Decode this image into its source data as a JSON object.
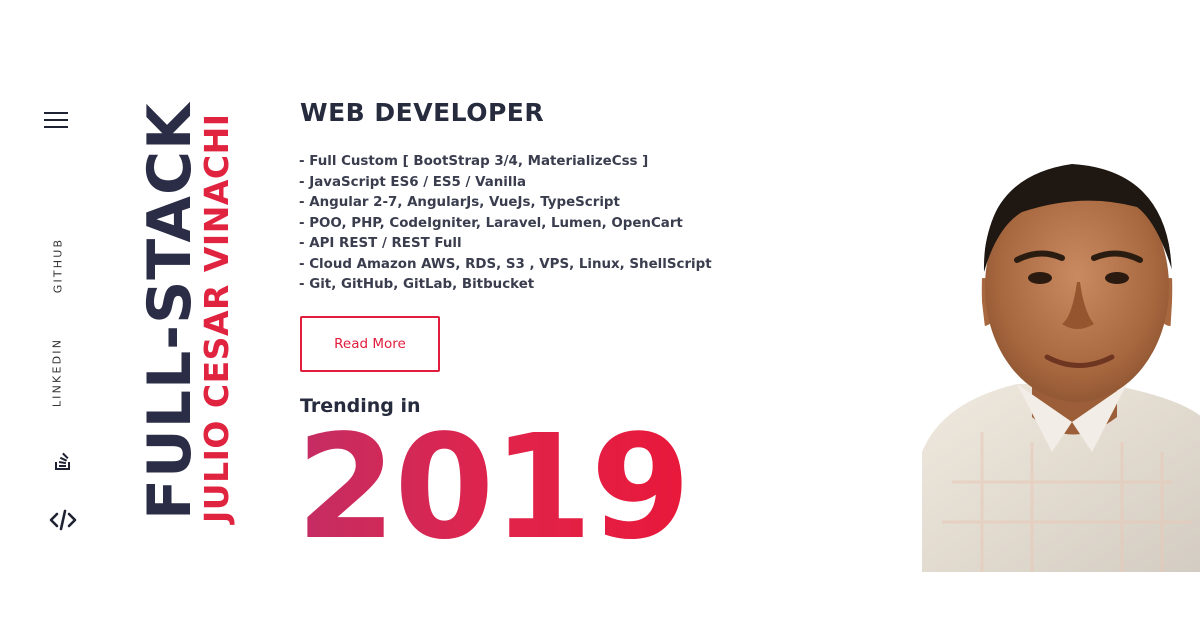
{
  "sidebar": {
    "menu_icon": "hamburger-icon",
    "links": [
      {
        "label": "GITHUB"
      },
      {
        "label": "LINKEDIN"
      }
    ],
    "icons": [
      "stackoverflow-icon",
      "code-icon"
    ]
  },
  "hero": {
    "vertical_title": "FULL-STACK",
    "vertical_name": "JULIO CESAR VINACHI",
    "headline": "WEB DEVELOPER",
    "skills": [
      "- Full Custom [ BootStrap 3/4, MaterializeCss ]",
      "- JavaScript ES6 / ES5 / Vanilla",
      "- Angular 2-7, AngularJs, VueJs, TypeScript",
      "- POO, PHP, CodeIgniter, Laravel, Lumen, OpenCart",
      "- API REST / REST Full",
      "- Cloud Amazon AWS, RDS, S3 , VPS, Linux, ShellScript",
      "- Git, GitHub, GitLab, Bitbucket"
    ],
    "read_more_label": "Read More",
    "trending_label": "Trending in",
    "year": "2019"
  },
  "colors": {
    "accent": "#e11d3d",
    "dark": "#262b3d"
  }
}
